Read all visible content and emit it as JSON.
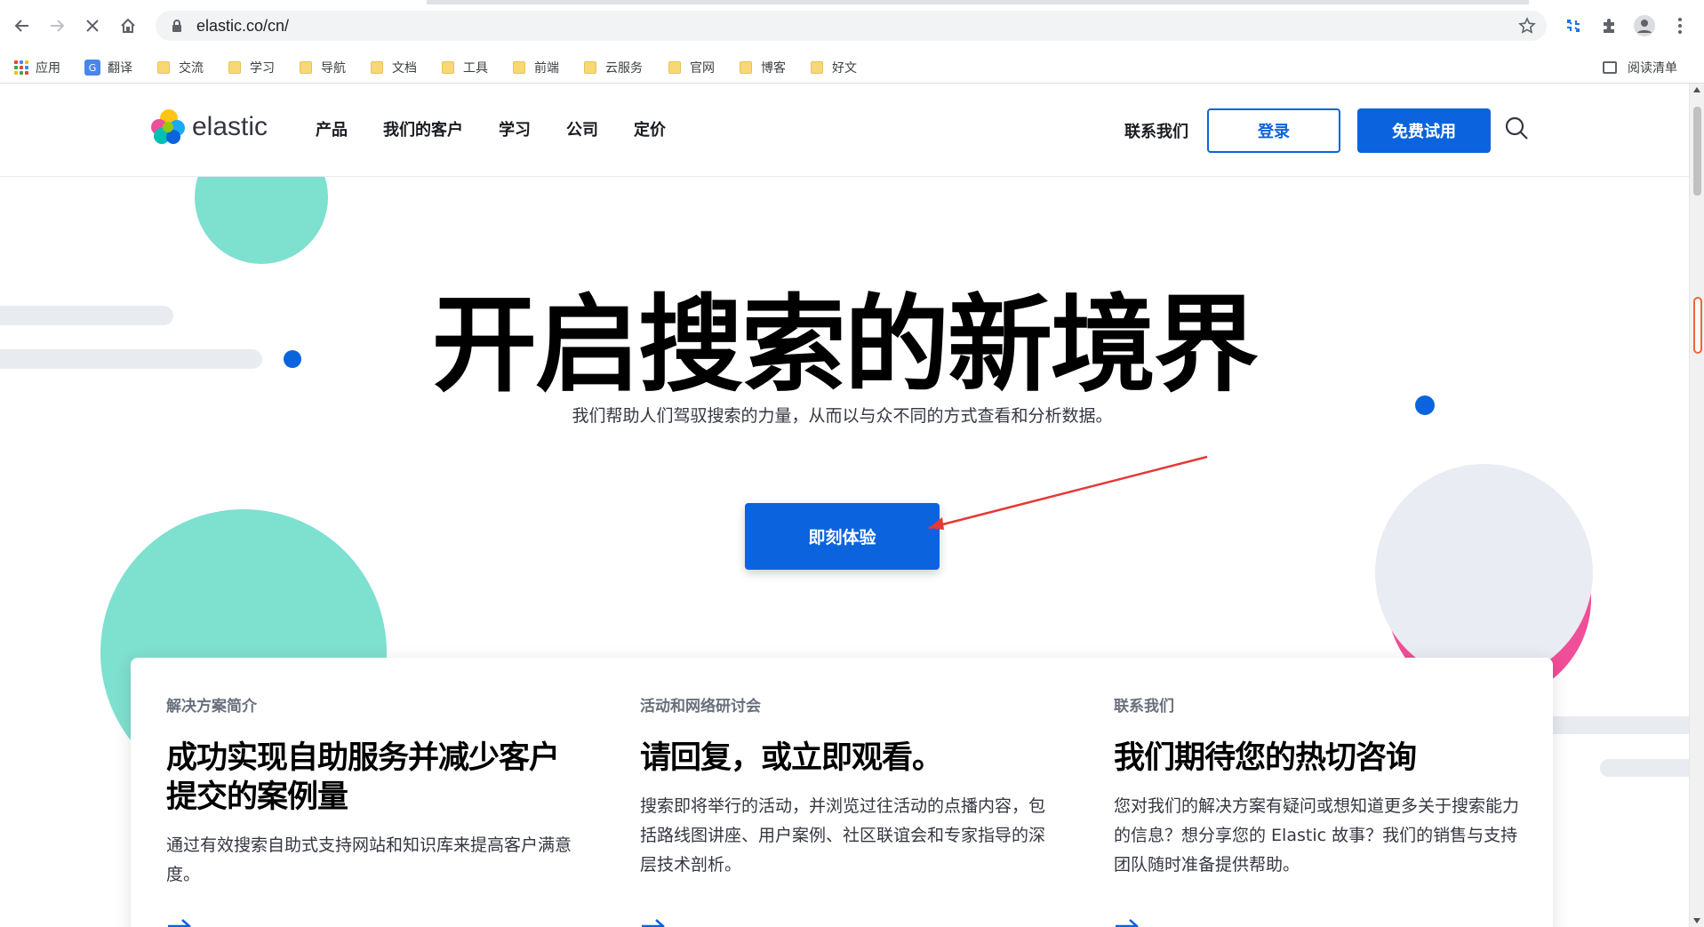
{
  "browser": {
    "url": "elastic.co/cn/",
    "bookmarks": [
      {
        "label": "应用",
        "icon": "apps-grid-icon"
      },
      {
        "label": "翻译",
        "icon": "translate-icon"
      },
      {
        "label": "交流",
        "icon": "folder-icon"
      },
      {
        "label": "学习",
        "icon": "folder-icon"
      },
      {
        "label": "导航",
        "icon": "folder-icon"
      },
      {
        "label": "文档",
        "icon": "folder-icon"
      },
      {
        "label": "工具",
        "icon": "folder-icon"
      },
      {
        "label": "前端",
        "icon": "folder-icon"
      },
      {
        "label": "云服务",
        "icon": "folder-icon"
      },
      {
        "label": "官网",
        "icon": "folder-icon"
      },
      {
        "label": "博客",
        "icon": "folder-icon"
      },
      {
        "label": "好文",
        "icon": "folder-icon"
      }
    ],
    "reading_list": "阅读清单"
  },
  "header": {
    "logo_text": "elastic",
    "nav": [
      "产品",
      "我们的客户",
      "学习",
      "公司",
      "定价"
    ],
    "contact": "联系我们",
    "login": "登录",
    "trial": "免费试用"
  },
  "hero": {
    "title": "开启搜索的新境界",
    "subtitle": "我们帮助人们驾驭搜索的力量，从而以与众不同的方式查看和分析数据。",
    "cta": "即刻体验"
  },
  "cards": [
    {
      "kicker": "解决方案简介",
      "heading": "成功实现自助服务并减少客户提交的案例量",
      "body": "通过有效搜索自助式支持网站和知识库来提高客户满意度。"
    },
    {
      "kicker": "活动和网络研讨会",
      "heading": "请回复，或立即观看。",
      "body": "搜索即将举行的活动，并浏览过往活动的点播内容，包括路线图讲座、用户案例、社区联谊会和专家指导的深层技术剖析。"
    },
    {
      "kicker": "联系我们",
      "heading": "我们期待您的热切咨询",
      "body": "您对我们的解决方案有疑问或想知道更多关于搜索能力的信息？想分享您的 Elastic 故事？我们的销售与支持团队随时准备提供帮助。"
    }
  ],
  "colors": {
    "brand_blue": "#0b64dd",
    "teal": "#7ee0cf",
    "pink": "#f04e98",
    "annotation_red": "#e53935"
  }
}
